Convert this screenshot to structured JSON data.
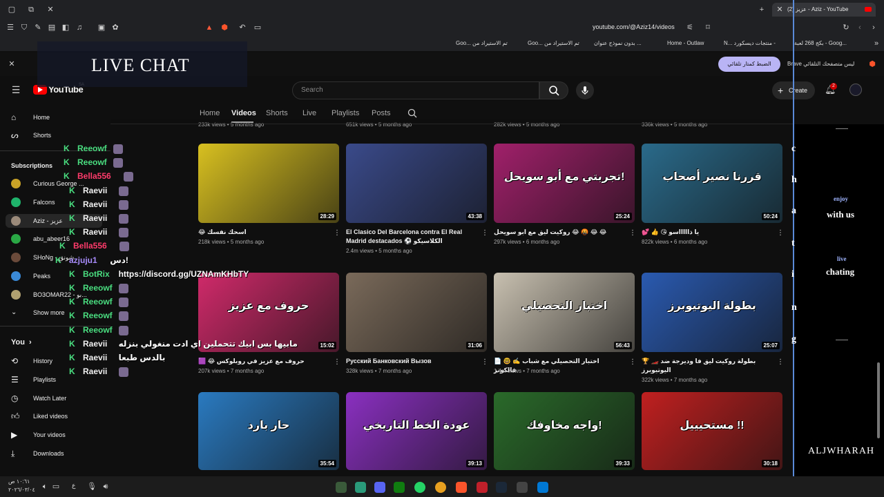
{
  "browser": {
    "tab_title": "(2) عزيز - Aziz - YouTube",
    "url": "youtube.com/@Aziz14/videos",
    "bookmarks": [
      "Goo... تم الاستيراد من",
      "Goo... تم الاستيراد من",
      "بدون نموذج عنوان ...",
      "Home - Outlaw",
      "N... منتجات ديسكورد -",
      "بكج 268 لعبة - Goog..."
    ],
    "infobar_text": "Brave ليس متصفحك التلقائي",
    "infobar_button": "الضبط كمتار تلقائي"
  },
  "youtube": {
    "logo": "YouTube",
    "logo_region": "SA",
    "search_placeholder": "Search",
    "create_label": "Create",
    "notif_count": "2"
  },
  "sidebar": {
    "main": [
      {
        "label": "Home",
        "icon": "home-icon"
      },
      {
        "label": "Shorts",
        "icon": "shorts-icon"
      }
    ],
    "subscriptions_title": "Subscriptions",
    "subscriptions": [
      {
        "label": "Curious George ...",
        "color": "#c9a227"
      },
      {
        "label": "Falcons",
        "color": "#1fb36b"
      },
      {
        "label": "Aziz - عزيز",
        "color": "#9b8a7a"
      },
      {
        "label": "abu_abeer16",
        "color": "#2aa845"
      },
      {
        "label": "SHoNg - شونق",
        "color": "#6a4a3a"
      },
      {
        "label": "Peaks",
        "color": "#3a8ad8"
      },
      {
        "label": "BO3OMAR22 - بو...",
        "color": "#b0a070"
      }
    ],
    "show_more": "Show more",
    "you_title": "You",
    "you_items": [
      {
        "label": "History",
        "icon": "history-icon"
      },
      {
        "label": "Playlists",
        "icon": "playlists-icon"
      },
      {
        "label": "Watch Later",
        "icon": "watch-later-icon"
      },
      {
        "label": "Liked videos",
        "icon": "like-icon"
      },
      {
        "label": "Your videos",
        "icon": "your-videos-icon"
      },
      {
        "label": "Downloads",
        "icon": "download-icon"
      }
    ]
  },
  "channel_tabs": [
    "Home",
    "Videos",
    "Shorts",
    "Live",
    "Playlists",
    "Posts"
  ],
  "prev_row_meta": [
    "233k views • 5 months ago",
    "651k views • 5 months ago",
    "282k views • 5 months ago",
    "336k views • 5 months ago"
  ],
  "videos": [
    {
      "title": "😂 اسحك نفسك",
      "meta": "218k views • 5 months ago",
      "duration": "28:29",
      "bg": "#d8c020",
      "overlay": ""
    },
    {
      "title": "El Clasico Del Barcelona contra El Real Madrid destacados ⚽ الكلاسيكو",
      "meta": "2.4m views • 5 months ago",
      "duration": "43:38",
      "bg": "#3a4a8a",
      "overlay": ""
    },
    {
      "title": "روكيت ليق مع ابو سويحل 😂 🤬 😂 😂",
      "meta": "297k views • 6 months ago",
      "duration": "25:24",
      "bg": "#a0206a",
      "overlay": "تجربتي مع أبو سويحل!"
    },
    {
      "title": "💕 👍 😘 يا ذاااااسو",
      "meta": "822k views • 6 months ago",
      "duration": "50:24",
      "bg": "#2a6a8a",
      "overlay": "قررنا نصير أصحاب"
    },
    {
      "title": "🟪 😂 حروف مع عزيز في روبلوكس",
      "meta": "207k views • 7 months ago",
      "duration": "15:02",
      "bg": "#d02a6a",
      "overlay": "حروف مع عزيز"
    },
    {
      "title": "Русский Банковский Вызов",
      "meta": "328k views • 7 months ago",
      "duration": "31:06",
      "bg": "#7a6a5a",
      "overlay": ""
    },
    {
      "title": "📄 🤓 ✍️ اختبار التحصيلي مع شباب فالكونز",
      "meta": "1.4m views • 7 months ago",
      "duration": "56:43",
      "bg": "#c8c0b0",
      "overlay": "اختبار التحصيلي"
    },
    {
      "title": "🏆 🏎️ بطولة روكيت ليق فا وديرجة ضد اليوتيوبرز",
      "meta": "322k views • 7 months ago",
      "duration": "25:07",
      "bg": "#2a5ab0",
      "overlay": "بطولة اليوتيوبرز"
    },
    {
      "title": "",
      "meta": "",
      "duration": "35:54",
      "bg": "#2a7ac0",
      "overlay": "حار بارد"
    },
    {
      "title": "",
      "meta": "",
      "duration": "39:13",
      "bg": "#8a30c0",
      "overlay": "عودة الخط التاريخي"
    },
    {
      "title": "",
      "meta": "",
      "duration": "39:33",
      "bg": "#2a6a2a",
      "overlay": "واجه مخاوفك!"
    },
    {
      "title": "",
      "meta": "",
      "duration": "30:18",
      "bg": "#c02020",
      "overlay": "مستحيييل !!"
    }
  ],
  "live_chat": {
    "title": "LIVE CHAT",
    "messages": [
      {
        "name": "Reeowf",
        "color": "#4ade80",
        "msg": ""
      },
      {
        "name": "Reeowf",
        "color": "#4ade80",
        "msg": ""
      },
      {
        "name": "Bella556",
        "color": "#ff3b6b",
        "msg": ""
      },
      {
        "name": "Raevii",
        "color": "#f0f0f0",
        "msg": ""
      },
      {
        "name": "Raevii",
        "color": "#f0f0f0",
        "msg": ""
      },
      {
        "name": "Raevii",
        "color": "#f0f0f0",
        "msg": ""
      },
      {
        "name": "Raevii",
        "color": "#f0f0f0",
        "msg": ""
      },
      {
        "name": "Bella556",
        "color": "#ff3b6b",
        "msg": ""
      },
      {
        "name": "azjuju1",
        "color": "#a78bfa",
        "msg": "دس!"
      },
      {
        "name": "BotRix",
        "color": "#4ade80",
        "msg": "https://discord.gg/UZNAmKHbTY"
      },
      {
        "name": "Reeowf",
        "color": "#4ade80",
        "msg": ""
      },
      {
        "name": "Reeowf",
        "color": "#4ade80",
        "msg": ""
      },
      {
        "name": "Reeowf",
        "color": "#4ade80",
        "msg": ""
      },
      {
        "name": "Reeowf",
        "color": "#4ade80",
        "msg": ""
      },
      {
        "name": "Raevii",
        "color": "#f0f0f0",
        "msg": "مابيها بس ابيك تتحملين اي ادت منغولي بنزله"
      },
      {
        "name": "Raevii",
        "color": "#f0f0f0",
        "msg": "بالدس طبعا"
      },
      {
        "name": "Raevii",
        "color": "#f0f0f0",
        "msg": ""
      }
    ]
  },
  "right_overlay": {
    "letters": [
      "c",
      "h",
      "a",
      "t",
      "i",
      "n",
      "g"
    ],
    "enjoy": "enjoy",
    "with_us": "with us",
    "live": "live",
    "chating": "chating",
    "brand": "ALJWHARAH"
  },
  "taskbar": {
    "time": "١٠:٦١ ص",
    "date": "٢٠٢٦/٠٣/٠٤",
    "lang": "ع"
  }
}
